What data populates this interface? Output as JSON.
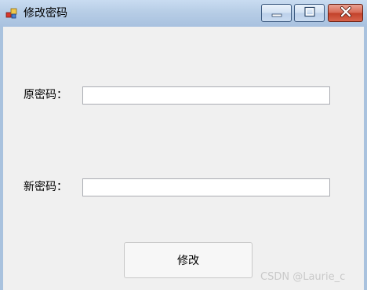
{
  "window": {
    "title": "修改密码",
    "icon": "app-icon",
    "controls": [
      "minimize-icon",
      "maximize-icon",
      "close-icon"
    ]
  },
  "form": {
    "old_password": {
      "label": "原密码：",
      "value": ""
    },
    "new_password": {
      "label": "新密码：",
      "value": ""
    },
    "submit_label": "修改"
  },
  "watermark": "CSDN @Laurie_c",
  "colors": {
    "titlebar": "#b7cde6",
    "client_background": "#f0f0f0",
    "close_button": "#c9452c"
  }
}
